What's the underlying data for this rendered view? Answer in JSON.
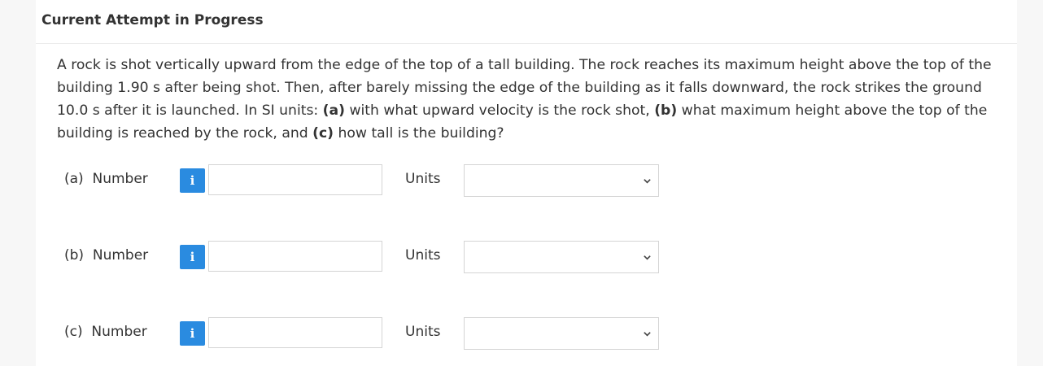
{
  "header": {
    "title": "Current Attempt in Progress"
  },
  "question": {
    "s1": "A rock is shot vertically upward from the edge of the top of a tall building. The rock reaches its maximum height above the top of the building 1.90 s after being shot. Then, after barely missing the edge of the building as it falls downward, the rock strikes the ground 10.0 s after it is launched. In SI units: ",
    "a": "(a)",
    "s2": " with what upward velocity is the rock shot, ",
    "b": "(b)",
    "s3": " what maximum height above the top of the building is reached by the rock, and ",
    "c": "(c)",
    "s4": " how tall is the building?"
  },
  "parts": [
    {
      "label": "(a)  Number",
      "number_value": "",
      "units_label": "Units",
      "units_value": ""
    },
    {
      "label": "(b)  Number",
      "number_value": "",
      "units_label": "Units",
      "units_value": ""
    },
    {
      "label": "(c)  Number",
      "number_value": "",
      "units_label": "Units",
      "units_value": ""
    }
  ],
  "icons": {
    "info": "info-icon",
    "dropdown": "chevron-down-icon"
  },
  "colors": {
    "info_button": "#2a8be0"
  }
}
